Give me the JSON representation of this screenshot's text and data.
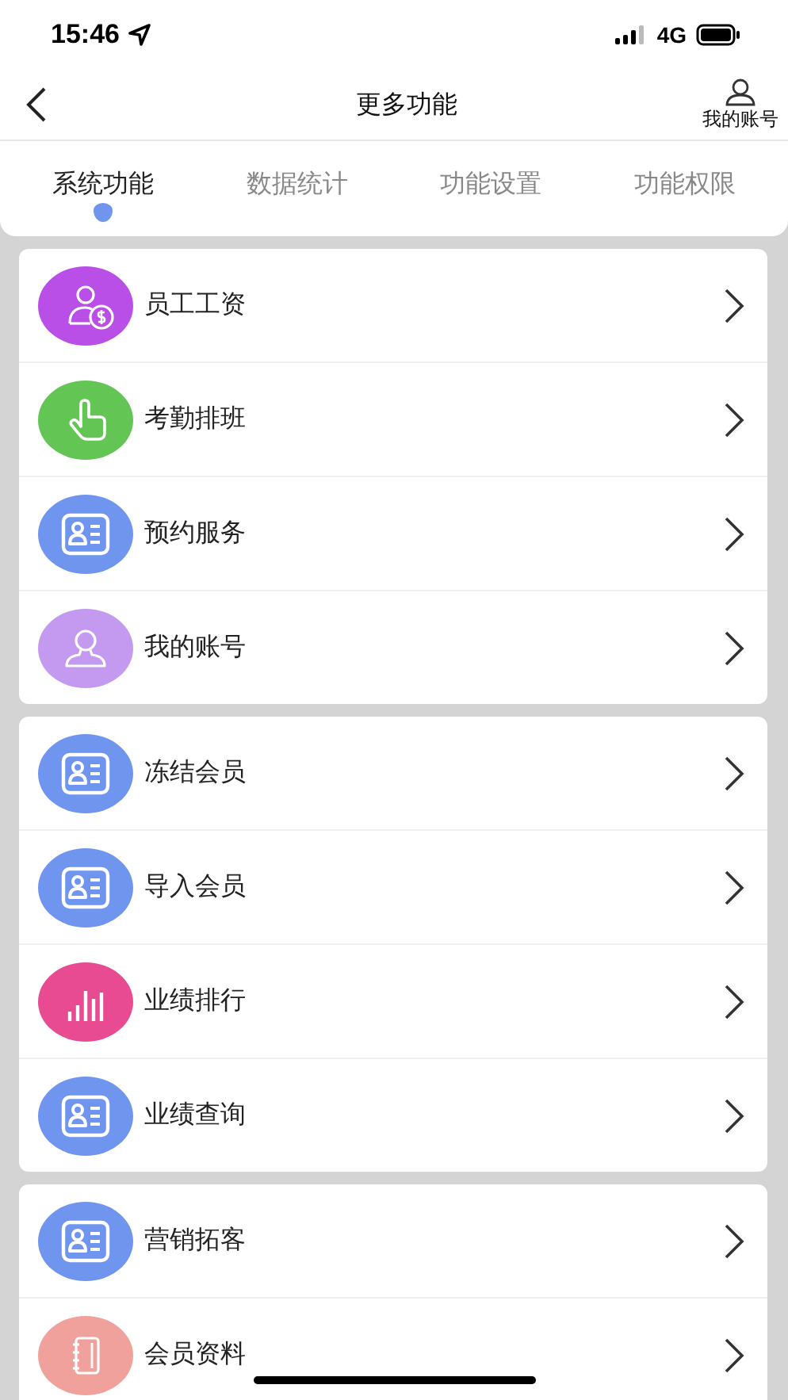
{
  "status_bar": {
    "time": "15:46",
    "network": "4G"
  },
  "header": {
    "title": "更多功能",
    "account_label": "我的账号"
  },
  "tabs": [
    {
      "label": "系统功能",
      "selected": true
    },
    {
      "label": "数据统计",
      "selected": false
    },
    {
      "label": "功能设置",
      "selected": false
    },
    {
      "label": "功能权限",
      "selected": false
    }
  ],
  "groups": [
    {
      "items": [
        {
          "label": "员工工资",
          "kind": "salary",
          "color": "#b94fe6"
        },
        {
          "label": "考勤排班",
          "kind": "hand",
          "color": "#62c554"
        },
        {
          "label": "预约服务",
          "kind": "card",
          "color": "#6f95ef"
        },
        {
          "label": "我的账号",
          "kind": "person",
          "color": "#c39af0"
        }
      ]
    },
    {
      "items": [
        {
          "label": "冻结会员",
          "kind": "card",
          "color": "#6f95ef"
        },
        {
          "label": "导入会员",
          "kind": "card",
          "color": "#6f95ef"
        },
        {
          "label": "业绩排行",
          "kind": "chart",
          "color": "#e84b91"
        },
        {
          "label": "业绩查询",
          "kind": "card",
          "color": "#6f95ef"
        }
      ]
    },
    {
      "items": [
        {
          "label": "营销拓客",
          "kind": "card",
          "color": "#6f95ef"
        },
        {
          "label": "会员资料",
          "kind": "book",
          "color": "#f0a19b"
        }
      ]
    }
  ]
}
